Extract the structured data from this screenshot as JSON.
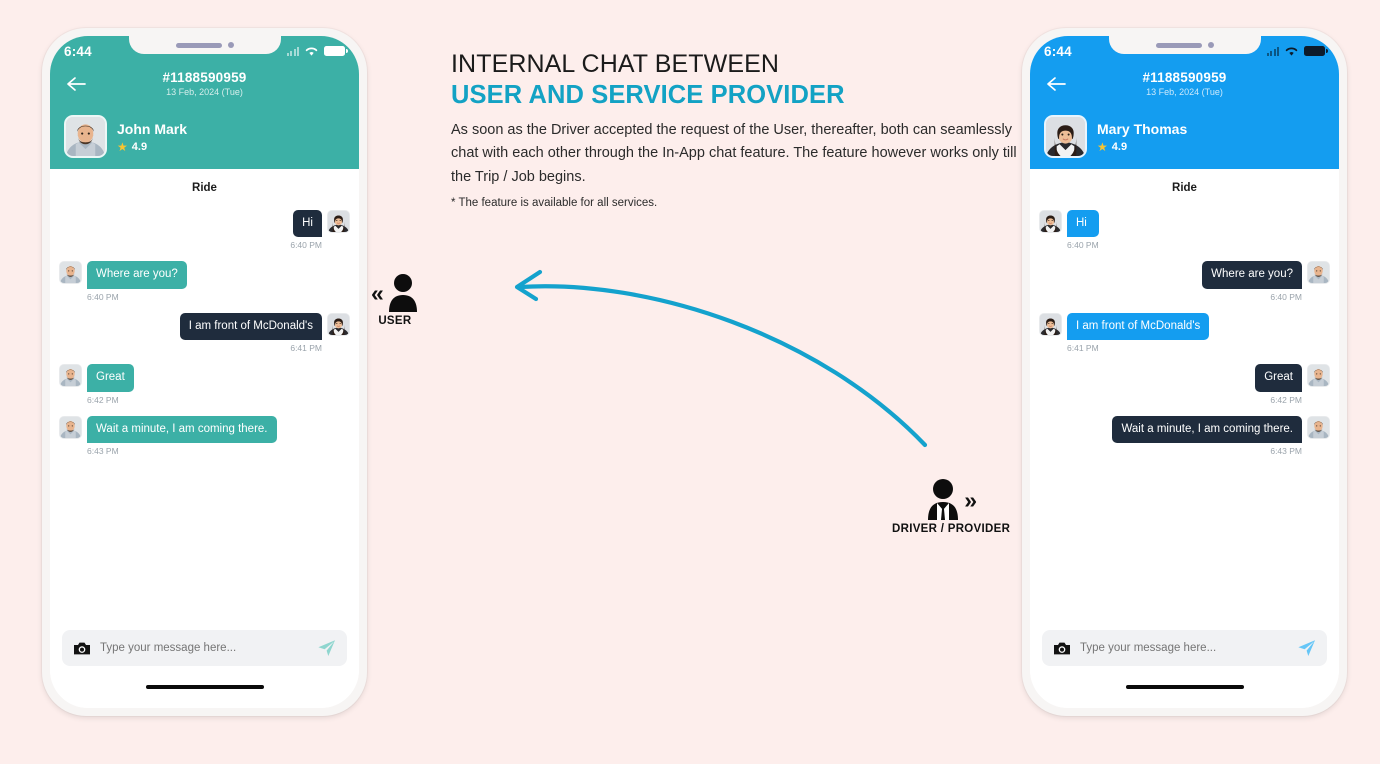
{
  "page": {
    "background": "#fdeeec",
    "accent_teal": "#3cb0a6",
    "accent_blue": "#149df0",
    "bubble_dark": "#1f2c3d",
    "heading_accent": "#13a2c4"
  },
  "copy": {
    "title_line1": "INTERNAL CHAT BETWEEN",
    "title_line2": "USER AND SERVICE PROVIDER",
    "body": "As soon as the Driver accepted the request of the User, thereafter, both can seamlessly chat with each other through the In-App chat feature. The feature however works only till the Trip / Job begins.",
    "note": "* The feature is available for all services."
  },
  "actors": {
    "user": {
      "label": "USER",
      "chevron": "«",
      "icon": "person-icon"
    },
    "driver": {
      "label": "DRIVER / PROVIDER",
      "chevron": "»",
      "icon": "business-person-icon"
    }
  },
  "phones": [
    {
      "id": "user-phone",
      "theme": "teal",
      "status": {
        "clock": "6:44",
        "signal": "signal-icon",
        "wifi": "wifi-icon",
        "battery": "battery-icon"
      },
      "header": {
        "back": "back-arrow-icon",
        "trip_id": "#1188590959",
        "trip_date": "13 Feb, 2024 (Tue)",
        "person_name": "John Mark",
        "rating": "4.9",
        "star": "★"
      },
      "section_label": "Ride",
      "messages": [
        {
          "text": "Hi",
          "time": "6:40 PM",
          "side": "right",
          "style": "other",
          "avatar": "woman"
        },
        {
          "text": "Where are you?",
          "time": "6:40 PM",
          "side": "left",
          "style": "self",
          "avatar": "man"
        },
        {
          "text": "I am front of McDonald's",
          "time": "6:41 PM",
          "side": "right",
          "style": "other",
          "avatar": "woman"
        },
        {
          "text": "Great",
          "time": "6:42 PM",
          "side": "left",
          "style": "self",
          "avatar": "man"
        },
        {
          "text": "Wait a minute, I am coming there.",
          "time": "6:43 PM",
          "side": "left",
          "style": "self",
          "avatar": "man"
        }
      ],
      "composer": {
        "camera": "camera-icon",
        "placeholder": "Type your message here...",
        "value": "",
        "send": "send-icon"
      }
    },
    {
      "id": "driver-phone",
      "theme": "blue",
      "status": {
        "clock": "6:44",
        "signal": "signal-icon",
        "wifi": "wifi-icon",
        "battery": "battery-icon"
      },
      "header": {
        "back": "back-arrow-icon",
        "trip_id": "#1188590959",
        "trip_date": "13 Feb, 2024 (Tue)",
        "person_name": "Mary Thomas",
        "rating": "4.9",
        "star": "★"
      },
      "section_label": "Ride",
      "messages": [
        {
          "text": "Hi",
          "time": "6:40 PM",
          "side": "left",
          "style": "self",
          "avatar": "woman"
        },
        {
          "text": "Where are you?",
          "time": "6:40 PM",
          "side": "right",
          "style": "other",
          "avatar": "man"
        },
        {
          "text": "I am front of McDonald's",
          "time": "6:41 PM",
          "side": "left",
          "style": "self",
          "avatar": "woman"
        },
        {
          "text": "Great",
          "time": "6:42 PM",
          "side": "right",
          "style": "other",
          "avatar": "man"
        },
        {
          "text": "Wait a minute, I am coming there.",
          "time": "6:43 PM",
          "side": "right",
          "style": "other",
          "avatar": "man"
        }
      ],
      "composer": {
        "camera": "camera-icon",
        "placeholder": "Type your message here...",
        "value": "",
        "send": "send-icon"
      }
    }
  ]
}
